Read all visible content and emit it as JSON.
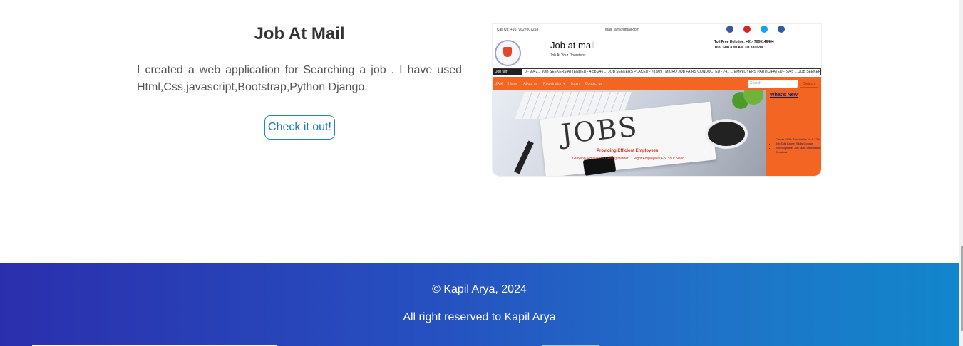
{
  "project": {
    "title": "Job At Mail",
    "description": "I created a web application for Searching a job . I have used Html,Css,javascript,Bootstrap,Python Django.",
    "button_label": "Check it out!"
  },
  "screenshot": {
    "call_text": "Call Us: +91- 9627007258",
    "mail_text": "Mail: jam@gmail.com",
    "social_icons": [
      "facebook-icon",
      "youtube-icon",
      "twitter-icon",
      "instagram-icon"
    ],
    "social_colors": [
      "#3b5998",
      "#cc2a2a",
      "#1da1f2",
      "#2a5d9a"
    ],
    "brand": "Job at mail",
    "tagline": "Job At Your Doorsteps",
    "helpline_line1": "Toll Free Helpline: +91- 7000146404",
    "helpline_line2": "Tue- Sun 8.00 AM TO 8.00PM",
    "ticker_label": "Job fair",
    "ticker_text": "0 - 9942... JOB SEEKERS ATTENDED - 4,58,246 ... JOB SEEKERS PLACED - 78,909 ; MICRO JOB FAIRS CONDUCTED - 741 ... EMPLOYERS PARTICIPATED - 5945 ... JOB SEEKERS ATTENDE",
    "nav_items": [
      "JAM",
      "Home",
      "About us",
      "Registration ▾",
      "Login",
      "Contact us"
    ],
    "search_placeholder": "Search",
    "search_button": "Search",
    "hero_word": "JOBS",
    "hero_caption": "Providing Efficient Employees",
    "hero_subcaption": "Growing A Business Getting Harder ... Right Employees For Your Need",
    "side_title": "What's New",
    "side_items": [
      "Career Skills Session for 10 & 12th",
      "Job Talk Career Skills Course",
      "\"Employment\" Job skills Information Sessions"
    ],
    "accent_orange": "#f26522"
  },
  "footer": {
    "copyright": "© Kapil Arya, 2024",
    "rights": "All right reserved to Kapil Arya"
  }
}
